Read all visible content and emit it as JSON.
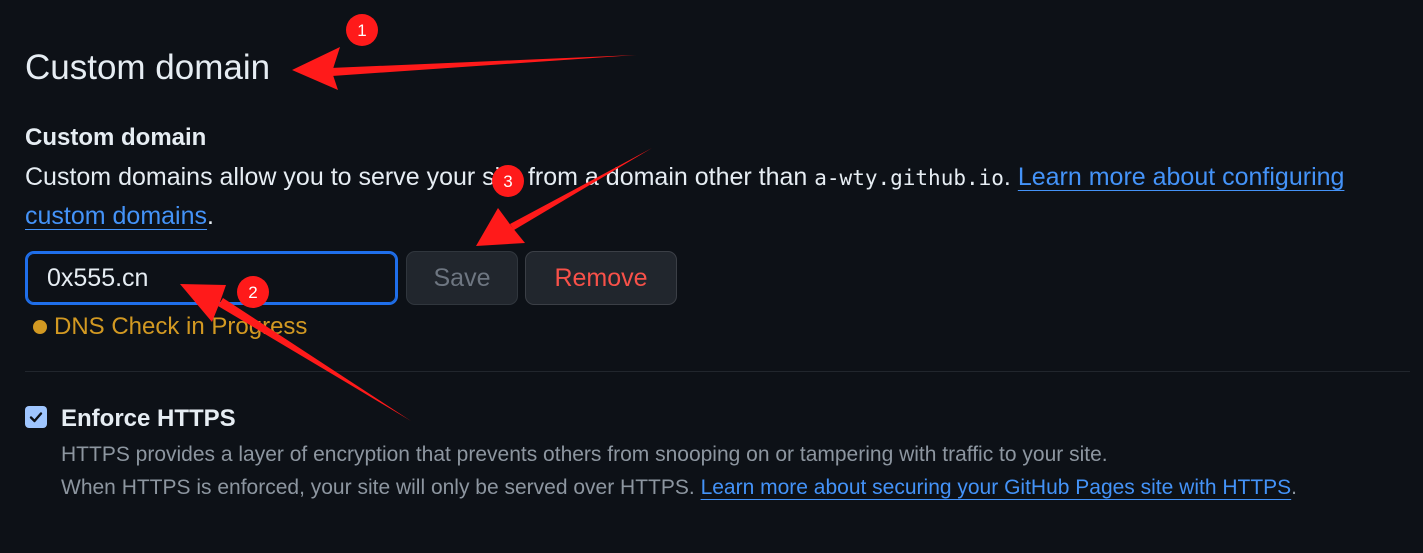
{
  "section": {
    "title": "Custom domain"
  },
  "custom_domain": {
    "label": "Custom domain",
    "description_before": "Custom domains allow you to serve your site from a domain other than ",
    "domain_code": "a-wty.github.io",
    "description_mid": ". ",
    "learn_more_link": "Learn more about configuring custom domains",
    "description_after": ".",
    "input_value": "0x555.cn",
    "save_label": "Save",
    "remove_label": "Remove",
    "dns_status": "DNS Check in Progress"
  },
  "https": {
    "title": "Enforce HTTPS",
    "checked": true,
    "line1": "HTTPS provides a layer of encryption that prevents others from snooping on or tampering with traffic to your site.",
    "line2_before": "When HTTPS is enforced, your site will only be served over HTTPS. ",
    "learn_more_link": "Learn more about securing your GitHub Pages site with HTTPS",
    "line2_after": "."
  },
  "annotations": {
    "badge_1": "1",
    "badge_2": "2",
    "badge_3": "3",
    "color": "#ff1a1a"
  },
  "colors": {
    "background": "#0d1117",
    "link": "#4493f8",
    "danger": "#f85149",
    "attention": "#d29922",
    "focus_border": "#1f6feb"
  }
}
